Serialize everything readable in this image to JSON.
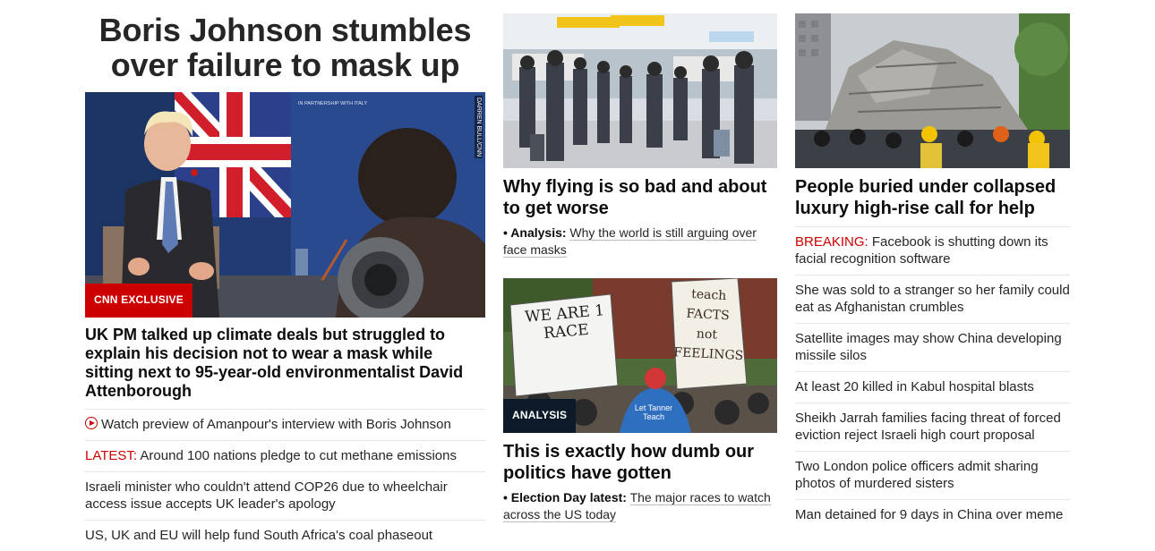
{
  "lead": {
    "title": "Boris Johnson stumbles over failure to mask up",
    "badge": "CNN EXCLUSIVE",
    "photo_credit": "DARREN BULL/CNN",
    "backdrop_text": "IN PARTNERSHIP WITH ITALY",
    "headline": "UK PM talked up climate deals but struggled to explain his decision not to wear a mask while sitting next to 95-year-old environmentalist David Attenborough",
    "links": [
      {
        "prefix": "",
        "text": "Watch preview of Amanpour's interview with Boris Johnson",
        "icon": "play-icon"
      },
      {
        "prefix": "LATEST:",
        "text": " Around 100 nations pledge to cut methane emissions"
      },
      {
        "prefix": "",
        "text": "Israeli minister who couldn't attend COP26 due to wheelchair access issue accepts UK leader's apology"
      },
      {
        "prefix": "",
        "text": "US, UK and EU will help fund South Africa's coal phaseout"
      }
    ]
  },
  "middle": {
    "story1": {
      "headline": "Why flying is so bad and about to get worse",
      "sub_label": "Analysis:",
      "sub_text": "Why the world is still arguing over face masks"
    },
    "story2": {
      "badge": "ANALYSIS",
      "sign1": "WE ARE 1 RACE",
      "sign2": "teach FACTS not FEELINGS",
      "shirt": "Let Tanner Teach",
      "headline": "This is exactly how dumb our politics have gotten",
      "sub_label": "Election Day latest:",
      "sub_text": "The major races to watch across the US today"
    }
  },
  "right": {
    "headline": "People buried under collapsed luxury high-rise call for help",
    "links": [
      {
        "prefix": "BREAKING:",
        "text": " Facebook is shutting down its facial recognition software"
      },
      {
        "prefix": "",
        "text": "She was sold to a stranger so her family could eat as Afghanistan crumbles"
      },
      {
        "prefix": "",
        "text": "Satellite images may show China developing missile silos"
      },
      {
        "prefix": "",
        "text": "At least 20 killed in Kabul hospital blasts"
      },
      {
        "prefix": "",
        "text": "Sheikh Jarrah families facing threat of forced eviction reject Israeli high court proposal"
      },
      {
        "prefix": "",
        "text": "Two London police officers admit sharing photos of murdered sisters"
      },
      {
        "prefix": "",
        "text": "Man detained for 9 days in China over meme"
      }
    ]
  },
  "colors": {
    "accent_red": "#cc0000",
    "badge_dark": "#0c1a2a",
    "text": "#0c0c0c"
  }
}
